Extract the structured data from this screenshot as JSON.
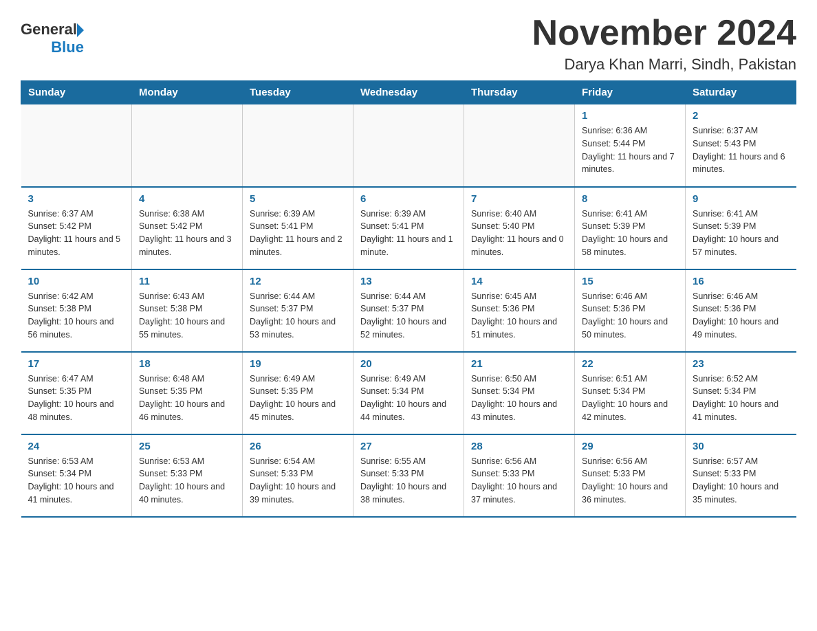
{
  "header": {
    "logo_general": "General",
    "logo_blue": "Blue",
    "month_title": "November 2024",
    "location": "Darya Khan Marri, Sindh, Pakistan"
  },
  "days_of_week": [
    "Sunday",
    "Monday",
    "Tuesday",
    "Wednesday",
    "Thursday",
    "Friday",
    "Saturday"
  ],
  "weeks": [
    [
      {
        "day": "",
        "info": ""
      },
      {
        "day": "",
        "info": ""
      },
      {
        "day": "",
        "info": ""
      },
      {
        "day": "",
        "info": ""
      },
      {
        "day": "",
        "info": ""
      },
      {
        "day": "1",
        "info": "Sunrise: 6:36 AM\nSunset: 5:44 PM\nDaylight: 11 hours and 7 minutes."
      },
      {
        "day": "2",
        "info": "Sunrise: 6:37 AM\nSunset: 5:43 PM\nDaylight: 11 hours and 6 minutes."
      }
    ],
    [
      {
        "day": "3",
        "info": "Sunrise: 6:37 AM\nSunset: 5:42 PM\nDaylight: 11 hours and 5 minutes."
      },
      {
        "day": "4",
        "info": "Sunrise: 6:38 AM\nSunset: 5:42 PM\nDaylight: 11 hours and 3 minutes."
      },
      {
        "day": "5",
        "info": "Sunrise: 6:39 AM\nSunset: 5:41 PM\nDaylight: 11 hours and 2 minutes."
      },
      {
        "day": "6",
        "info": "Sunrise: 6:39 AM\nSunset: 5:41 PM\nDaylight: 11 hours and 1 minute."
      },
      {
        "day": "7",
        "info": "Sunrise: 6:40 AM\nSunset: 5:40 PM\nDaylight: 11 hours and 0 minutes."
      },
      {
        "day": "8",
        "info": "Sunrise: 6:41 AM\nSunset: 5:39 PM\nDaylight: 10 hours and 58 minutes."
      },
      {
        "day": "9",
        "info": "Sunrise: 6:41 AM\nSunset: 5:39 PM\nDaylight: 10 hours and 57 minutes."
      }
    ],
    [
      {
        "day": "10",
        "info": "Sunrise: 6:42 AM\nSunset: 5:38 PM\nDaylight: 10 hours and 56 minutes."
      },
      {
        "day": "11",
        "info": "Sunrise: 6:43 AM\nSunset: 5:38 PM\nDaylight: 10 hours and 55 minutes."
      },
      {
        "day": "12",
        "info": "Sunrise: 6:44 AM\nSunset: 5:37 PM\nDaylight: 10 hours and 53 minutes."
      },
      {
        "day": "13",
        "info": "Sunrise: 6:44 AM\nSunset: 5:37 PM\nDaylight: 10 hours and 52 minutes."
      },
      {
        "day": "14",
        "info": "Sunrise: 6:45 AM\nSunset: 5:36 PM\nDaylight: 10 hours and 51 minutes."
      },
      {
        "day": "15",
        "info": "Sunrise: 6:46 AM\nSunset: 5:36 PM\nDaylight: 10 hours and 50 minutes."
      },
      {
        "day": "16",
        "info": "Sunrise: 6:46 AM\nSunset: 5:36 PM\nDaylight: 10 hours and 49 minutes."
      }
    ],
    [
      {
        "day": "17",
        "info": "Sunrise: 6:47 AM\nSunset: 5:35 PM\nDaylight: 10 hours and 48 minutes."
      },
      {
        "day": "18",
        "info": "Sunrise: 6:48 AM\nSunset: 5:35 PM\nDaylight: 10 hours and 46 minutes."
      },
      {
        "day": "19",
        "info": "Sunrise: 6:49 AM\nSunset: 5:35 PM\nDaylight: 10 hours and 45 minutes."
      },
      {
        "day": "20",
        "info": "Sunrise: 6:49 AM\nSunset: 5:34 PM\nDaylight: 10 hours and 44 minutes."
      },
      {
        "day": "21",
        "info": "Sunrise: 6:50 AM\nSunset: 5:34 PM\nDaylight: 10 hours and 43 minutes."
      },
      {
        "day": "22",
        "info": "Sunrise: 6:51 AM\nSunset: 5:34 PM\nDaylight: 10 hours and 42 minutes."
      },
      {
        "day": "23",
        "info": "Sunrise: 6:52 AM\nSunset: 5:34 PM\nDaylight: 10 hours and 41 minutes."
      }
    ],
    [
      {
        "day": "24",
        "info": "Sunrise: 6:53 AM\nSunset: 5:34 PM\nDaylight: 10 hours and 41 minutes."
      },
      {
        "day": "25",
        "info": "Sunrise: 6:53 AM\nSunset: 5:33 PM\nDaylight: 10 hours and 40 minutes."
      },
      {
        "day": "26",
        "info": "Sunrise: 6:54 AM\nSunset: 5:33 PM\nDaylight: 10 hours and 39 minutes."
      },
      {
        "day": "27",
        "info": "Sunrise: 6:55 AM\nSunset: 5:33 PM\nDaylight: 10 hours and 38 minutes."
      },
      {
        "day": "28",
        "info": "Sunrise: 6:56 AM\nSunset: 5:33 PM\nDaylight: 10 hours and 37 minutes."
      },
      {
        "day": "29",
        "info": "Sunrise: 6:56 AM\nSunset: 5:33 PM\nDaylight: 10 hours and 36 minutes."
      },
      {
        "day": "30",
        "info": "Sunrise: 6:57 AM\nSunset: 5:33 PM\nDaylight: 10 hours and 35 minutes."
      }
    ]
  ]
}
